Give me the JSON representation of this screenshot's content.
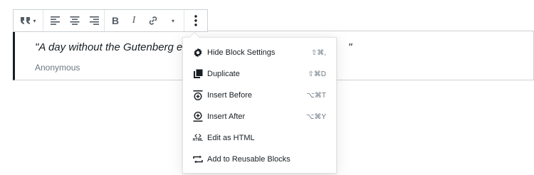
{
  "toolbar": {
    "quote_style_caret": "▾",
    "bold_label": "B",
    "italic_label": "I",
    "link_caret": "▾"
  },
  "block": {
    "quote_text": "\"A day without the Gutenberg editor",
    "quote_end": "\"",
    "citation": "Anonymous"
  },
  "menu": {
    "items": [
      {
        "label": "Hide Block Settings",
        "shortcut": "⇧⌘,",
        "icon": "gear-icon"
      },
      {
        "label": "Duplicate",
        "shortcut": "⇧⌘D",
        "icon": "duplicate-icon"
      },
      {
        "label": "Insert Before",
        "shortcut": "⌥⌘T",
        "icon": "insert-before-icon"
      },
      {
        "label": "Insert After",
        "shortcut": "⌥⌘Y",
        "icon": "insert-after-icon"
      },
      {
        "label": "Edit as HTML",
        "shortcut": "",
        "icon": "html-icon"
      },
      {
        "label": "Add to Reusable Blocks",
        "shortcut": "",
        "icon": "reusable-block-icon"
      }
    ],
    "html_icon_text": "HTML"
  }
}
